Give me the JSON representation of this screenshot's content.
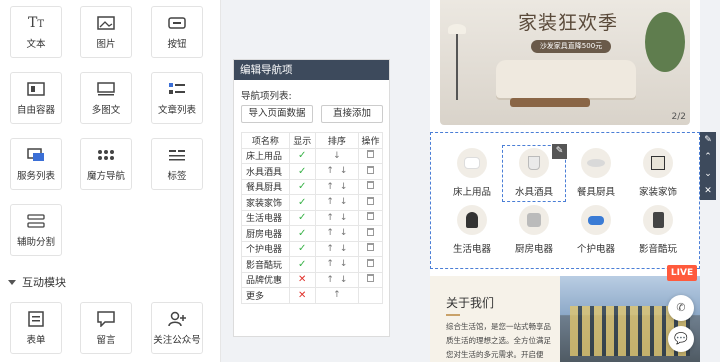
{
  "widgets": {
    "items": [
      {
        "label": "文本",
        "icon": "text-icon"
      },
      {
        "label": "图片",
        "icon": "image-icon"
      },
      {
        "label": "按钮",
        "icon": "button-icon"
      },
      {
        "label": "自由容器",
        "icon": "container-icon"
      },
      {
        "label": "多图文",
        "icon": "multi-image-text-icon"
      },
      {
        "label": "文章列表",
        "icon": "article-list-icon"
      },
      {
        "label": "服务列表",
        "icon": "service-list-icon"
      },
      {
        "label": "魔方导航",
        "icon": "cube-nav-icon"
      },
      {
        "label": "标签",
        "icon": "tag-icon"
      },
      {
        "label": "辅助分割",
        "icon": "divider-icon"
      }
    ],
    "section_title": "互动模块",
    "interactive_items": [
      {
        "label": "表单",
        "icon": "form-icon"
      },
      {
        "label": "留言",
        "icon": "message-icon"
      },
      {
        "label": "关注公众号",
        "icon": "follow-account-icon"
      }
    ]
  },
  "editor": {
    "header": "编辑导航项",
    "list_label": "导航项列表:",
    "import_button": "导入页面数据",
    "add_button": "直接添加",
    "columns": [
      "项名称",
      "显示",
      "排序",
      "操作"
    ],
    "rows": [
      {
        "name": "床上用品",
        "visible": true
      },
      {
        "name": "水具酒具",
        "visible": true
      },
      {
        "name": "餐具厨具",
        "visible": true
      },
      {
        "name": "家装家饰",
        "visible": true
      },
      {
        "name": "生活电器",
        "visible": true
      },
      {
        "name": "厨房电器",
        "visible": true
      },
      {
        "name": "个护电器",
        "visible": true
      },
      {
        "name": "影音酷玩",
        "visible": true
      },
      {
        "name": "品牌优惠",
        "visible": false
      },
      {
        "name": "更多",
        "visible": false
      }
    ]
  },
  "preview": {
    "banner_title": "家装狂欢季",
    "banner_subtitle": "沙发家具直降500元",
    "banner_page": "2/2",
    "nav_items": [
      "床上用品",
      "水具酒具",
      "餐具厨具",
      "家装家饰",
      "生活电器",
      "厨房电器",
      "个护电器",
      "影音酷玩"
    ],
    "about_title": "关于我们",
    "about_text": "综合生活馆，是您一站式畅享品质生活的理想之选。全方位满足您对生活的多元需求。开启便",
    "live_badge": "LIVE"
  },
  "colors": {
    "editor_header": "#3d4a5c",
    "check": "#3bb34a",
    "cross": "#e0312b",
    "selection": "#4a7ed6",
    "live": "#ff5a3c"
  }
}
